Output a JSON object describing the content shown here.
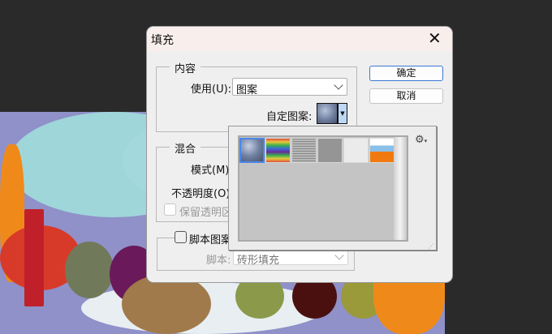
{
  "dialog": {
    "title": "填充",
    "close_icon": "close-icon"
  },
  "content_group": {
    "label": "内容",
    "use_label": "使用(U):",
    "use_value": "图案",
    "custom_pattern_label": "自定图案:"
  },
  "buttons": {
    "ok": "确定",
    "cancel": "取消"
  },
  "blend_group": {
    "label": "混合",
    "mode_label": "模式(M):",
    "opacity_label": "不透明度(O):",
    "preserve_label": "保留透明区"
  },
  "script_group": {
    "checkbox_label": "脚本图案",
    "script_label": "脚本:",
    "script_value": "砖形填充"
  },
  "pattern_picker": {
    "patterns": [
      "bubbles",
      "rainbow",
      "gray-noise-lines",
      "gray-noise",
      "white-noise",
      "landscape"
    ],
    "selected_index": 0,
    "menu_icon": "gear-icon"
  },
  "colors": {
    "accent": "#3a78d4",
    "title_bar": "#f8eeec",
    "dialog_bg": "#efefef"
  }
}
